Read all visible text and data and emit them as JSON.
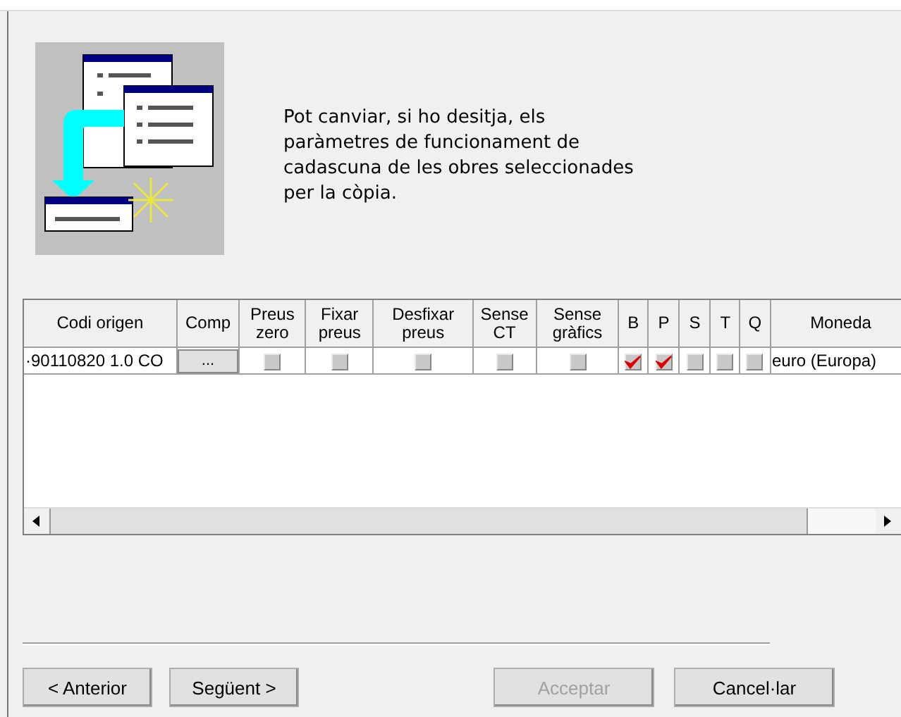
{
  "intro": {
    "text": "Pot canviar, si ho desitja, els paràmetres de funcionament de cadascuna de les obres seleccionades per la còpia."
  },
  "table": {
    "columns": [
      "Codi origen",
      "Comp",
      "Preus zero",
      "Fixar preus",
      "Desfixar preus",
      "Sense CT",
      "Sense gràfics",
      "B",
      "P",
      "S",
      "T",
      "Q",
      "Moneda"
    ],
    "rows": [
      {
        "cells": [
          {
            "kind": "text",
            "text": "·90110820 1.0 CO"
          },
          {
            "kind": "button",
            "text": "..."
          },
          {
            "kind": "check",
            "checked": false
          },
          {
            "kind": "check",
            "checked": false
          },
          {
            "kind": "check",
            "checked": false
          },
          {
            "kind": "check",
            "checked": false
          },
          {
            "kind": "check",
            "checked": false
          },
          {
            "kind": "check",
            "checked": true
          },
          {
            "kind": "check",
            "checked": true
          },
          {
            "kind": "check",
            "checked": false
          },
          {
            "kind": "check",
            "checked": false
          },
          {
            "kind": "check",
            "checked": false
          },
          {
            "kind": "text",
            "text": "euro (Europa)"
          }
        ]
      }
    ]
  },
  "buttons": [
    {
      "label": "< Anterior",
      "disabled": false
    },
    {
      "label": "Següent >",
      "disabled": false
    },
    {
      "label": "Acceptar",
      "disabled": true
    },
    {
      "label": "Cancel·lar",
      "disabled": false
    }
  ]
}
